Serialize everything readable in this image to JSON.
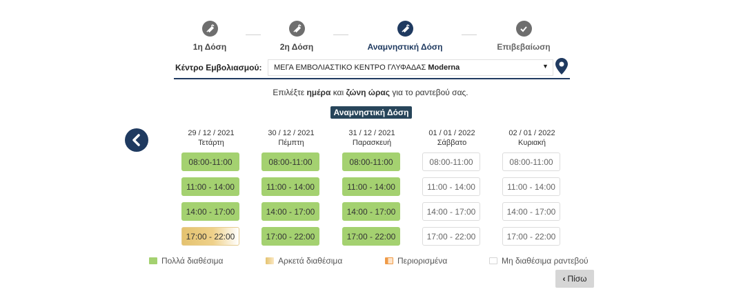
{
  "stepper": {
    "steps": [
      {
        "label": "1η Δόση",
        "icon": "syringe-icon"
      },
      {
        "label": "2η Δόση",
        "icon": "syringe-icon"
      },
      {
        "label": "Αναμνηστική Δόση",
        "icon": "syringe-icon",
        "active": true
      },
      {
        "label": "Επιβεβαίωση",
        "icon": "check-icon"
      }
    ]
  },
  "center": {
    "label": "Κέντρο Εμβολιασμού:",
    "value_prefix": "ΜΕΓΑ ΕΜΒΟΛΙΑΣΤΙΚΟ ΚΕΝΤΡΟ ΓΛΥΦΑΔΑΣ",
    "value_bold": "Moderna",
    "accent_color": "#1f3a60"
  },
  "instruction": {
    "part1": "Επιλέξτε ",
    "bold1": "ημέρα",
    "part2": " και ",
    "bold2": "ζώνη ώρας",
    "part3": " για το ραντεβού σας."
  },
  "dose_badge": "Αναμνηστική Δόση",
  "days": [
    {
      "date": "29 / 12 / 2021",
      "weekday": "Τετάρτη",
      "slots": [
        {
          "time": "08:00-11:00",
          "status": "many"
        },
        {
          "time": "11:00 - 14:00",
          "status": "many"
        },
        {
          "time": "14:00 - 17:00",
          "status": "many"
        },
        {
          "time": "17:00 - 22:00",
          "status": "enough"
        }
      ]
    },
    {
      "date": "30 / 12 / 2021",
      "weekday": "Πέμπτη",
      "slots": [
        {
          "time": "08:00-11:00",
          "status": "many"
        },
        {
          "time": "11:00 - 14:00",
          "status": "many"
        },
        {
          "time": "14:00 - 17:00",
          "status": "many"
        },
        {
          "time": "17:00 - 22:00",
          "status": "many"
        }
      ]
    },
    {
      "date": "31 / 12 / 2021",
      "weekday": "Παρασκευή",
      "slots": [
        {
          "time": "08:00-11:00",
          "status": "many"
        },
        {
          "time": "11:00 - 14:00",
          "status": "many"
        },
        {
          "time": "14:00 - 17:00",
          "status": "many"
        },
        {
          "time": "17:00 - 22:00",
          "status": "many"
        }
      ]
    },
    {
      "date": "01 / 01 / 2022",
      "weekday": "Σάββατο",
      "slots": [
        {
          "time": "08:00-11:00",
          "status": "none"
        },
        {
          "time": "11:00 - 14:00",
          "status": "none"
        },
        {
          "time": "14:00 - 17:00",
          "status": "none"
        },
        {
          "time": "17:00 - 22:00",
          "status": "none"
        }
      ]
    },
    {
      "date": "02 / 01 / 2022",
      "weekday": "Κυριακή",
      "slots": [
        {
          "time": "08:00-11:00",
          "status": "none"
        },
        {
          "time": "11:00 - 14:00",
          "status": "none"
        },
        {
          "time": "14:00 - 17:00",
          "status": "none"
        },
        {
          "time": "17:00 - 22:00",
          "status": "none"
        }
      ]
    }
  ],
  "legend": [
    {
      "label": "Πολλά διαθέσιμα",
      "color": "#a4d170"
    },
    {
      "label": "Αρκετά διαθέσιμα",
      "color": "#e4c26f"
    },
    {
      "label": "Περιορισμένα",
      "color": "#ef9b48"
    },
    {
      "label": "Μη διαθέσιμα ραντεβού",
      "color": "#ffffff"
    }
  ],
  "back_button": "Πίσω",
  "colors": {
    "many": "#a4d170",
    "enough": "#e4c26f",
    "limited": "#ef9b48",
    "navy": "#1f3a60"
  }
}
